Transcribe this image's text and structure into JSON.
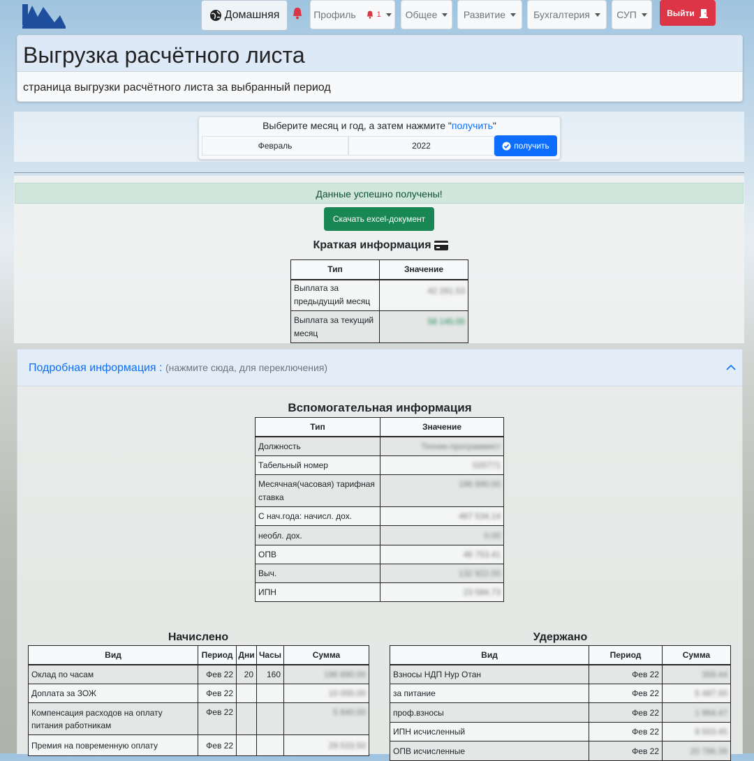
{
  "nav": {
    "home": "Домашняя",
    "profile": "Профиль",
    "profile_badge": "1",
    "general": "Общее",
    "development": "Развитие",
    "accounting": "Бухгалтерия",
    "sup": "СУП",
    "logout": "Выйти"
  },
  "page": {
    "title": "Выгрузка расчётного листа",
    "subtitle": "страница выгрузки расчётного листа за выбранный период"
  },
  "picker": {
    "hint_prefix": "Выберите месяц и год, а затем нажмите \"",
    "hint_link": "получить",
    "hint_suffix": "\"",
    "month": "Февраль",
    "year": "2022",
    "button": "получить"
  },
  "alert": "Данные успешно получены!",
  "excel_button": "Скачать excel-документ",
  "short_info": {
    "title": "Краткая информация",
    "headers": [
      "Тип",
      "Значение"
    ],
    "rows": [
      {
        "type": "Выплата за предыдущий месяц",
        "value": "42 281.53"
      },
      {
        "type": "Выплата за текущий месяц",
        "value": "58 145.05"
      }
    ]
  },
  "details": {
    "label": "Подробная информация :",
    "hint": "(нажмите сюда, для переключения)"
  },
  "aux_info": {
    "title": "Вспомогательная информация",
    "headers": [
      "Тип",
      "Значение"
    ],
    "rows": [
      {
        "type": "Должность",
        "value": "Техник-программист"
      },
      {
        "type": "Табельный номер",
        "value": "020771"
      },
      {
        "type": "Месячная(часовая) тарифная ставка",
        "value": "196 890.00"
      },
      {
        "type": "С нач.года: начисл. дох.",
        "value": "467 534.14"
      },
      {
        "type": "необл. дох.",
        "value": "0.00"
      },
      {
        "type": "ОПВ",
        "value": "46 753.41"
      },
      {
        "type": "Выч.",
        "value": "132 922.00"
      },
      {
        "type": "ИПН",
        "value": "23 584.73"
      }
    ]
  },
  "accrued": {
    "title": "Начислено",
    "headers": [
      "Вид",
      "Период",
      "Дни",
      "Часы",
      "Сумма"
    ],
    "rows": [
      {
        "type": "Оклад по часам",
        "period": "Фев 22",
        "days": "20",
        "hours": "160",
        "sum": "196 890.00"
      },
      {
        "type": "Доплата за ЗОЖ",
        "period": "Фев 22",
        "days": "",
        "hours": "",
        "sum": "10 000.00"
      },
      {
        "type": "Компенсация расходов на оплату питания работникам",
        "period": "Фев 22",
        "days": "",
        "hours": "",
        "sum": "5 840.00"
      },
      {
        "type": "Премия на повременную оплату",
        "period": "Фев 22",
        "days": "",
        "hours": "",
        "sum": "29 533.50"
      }
    ]
  },
  "deducted": {
    "title": "Удержано",
    "headers": [
      "Вид",
      "Период",
      "Сумма"
    ],
    "rows": [
      {
        "type": "Взносы НДП Нур Отан",
        "period": "Фев 22",
        "sum": "359.44"
      },
      {
        "type": "за питание",
        "period": "Фев 22",
        "sum": "5 487.00"
      },
      {
        "type": "проф.взносы",
        "period": "Фев 22",
        "sum": "1 964.47"
      },
      {
        "type": "ИПН исчисленный",
        "period": "Фев 22",
        "sum": "9 503.45"
      },
      {
        "type": "ОПВ исчисленные",
        "period": "Фев 22",
        "sum": "20 786.39"
      }
    ]
  }
}
